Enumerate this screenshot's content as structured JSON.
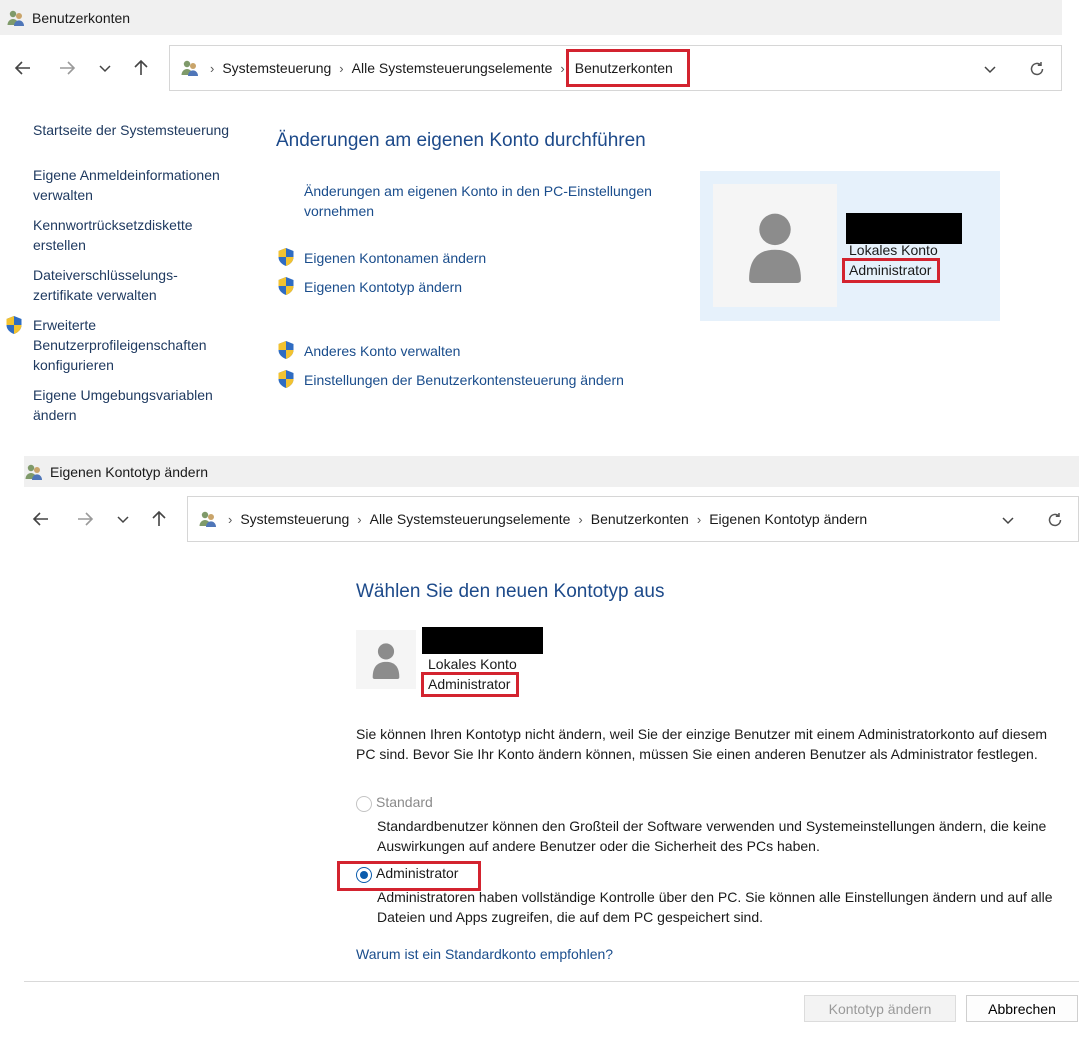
{
  "window1": {
    "title": "Benutzerkonten",
    "breadcrumb": [
      "Systemsteuerung",
      "Alle Systemsteuerungselemente",
      "Benutzerkonten"
    ],
    "sidebar": [
      "Startseite der Systemsteuerung",
      "Eigene Anmeldeinformationen verwalten",
      "Kennwortrücksetzdiskette erstellen",
      "Dateiverschlüsselungs-zertifikate verwalten",
      "Erweiterte Benutzerprofileigenschaften konfigurieren",
      "Eigene Umgebungsvariablen ändern"
    ],
    "heading": "Änderungen am eigenen Konto durchführen",
    "tasks": {
      "pc_settings": "Änderungen am eigenen Konto in den PC-Einstellungen vornehmen",
      "rename": "Eigenen Kontonamen ändern",
      "change_type": "Eigenen Kontotyp ändern",
      "manage_other": "Anderes Konto verwalten",
      "uac": "Einstellungen der Benutzerkontensteuerung ändern"
    },
    "account": {
      "type": "Lokales Konto",
      "role": "Administrator"
    }
  },
  "window2": {
    "title": "Eigenen Kontotyp ändern",
    "breadcrumb": [
      "Systemsteuerung",
      "Alle Systemsteuerungselemente",
      "Benutzerkonten",
      "Eigenen Kontotyp ändern"
    ],
    "heading": "Wählen Sie den neuen Kontotyp aus",
    "account": {
      "type": "Lokales Konto",
      "role": "Administrator"
    },
    "info": "Sie können Ihren Kontotyp nicht ändern, weil Sie der einzige Benutzer mit einem Administratorkonto auf diesem PC sind. Bevor Sie Ihr Konto ändern können, müssen Sie einen anderen Benutzer als Administrator festlegen.",
    "options": {
      "standard": {
        "label": "Standard",
        "desc": "Standardbenutzer können den Großteil der Software verwenden und Systemeinstellungen ändern, die keine Auswirkungen auf andere Benutzer oder die Sicherheit des PCs haben.",
        "checked": false
      },
      "admin": {
        "label": "Administrator",
        "desc": "Administratoren haben vollständige Kontrolle über den PC. Sie können alle Einstellungen ändern und auf alle Dateien und Apps zugreifen, die auf dem PC gespeichert sind.",
        "checked": true
      }
    },
    "why_link": "Warum ist ein Standardkonto empfohlen?",
    "buttons": {
      "change": "Kontotyp ändern",
      "cancel": "Abbrechen"
    }
  },
  "colors": {
    "highlight": "#d3232f",
    "link": "#1a4d8c",
    "heading": "#1d4a8a",
    "card": "#e6f1fb"
  },
  "icons": [
    "user-accounts-icon",
    "back-icon",
    "forward-icon",
    "history-dropdown-icon",
    "up-icon",
    "chevron-right-icon",
    "chevron-down-icon",
    "refresh-icon",
    "uac-shield-icon",
    "user-avatar-icon"
  ]
}
